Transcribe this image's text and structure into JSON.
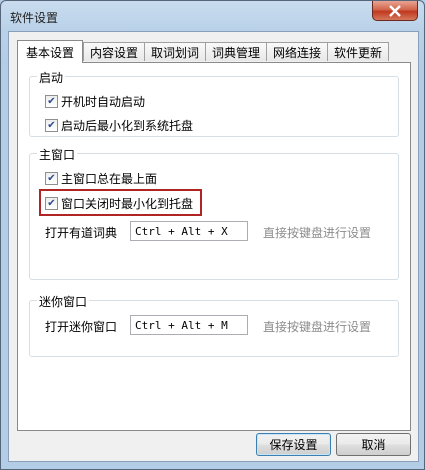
{
  "window": {
    "title": "软件设置"
  },
  "tabs": [
    {
      "label": "基本设置",
      "active": true
    },
    {
      "label": "内容设置",
      "active": false
    },
    {
      "label": "取词划词",
      "active": false
    },
    {
      "label": "词典管理",
      "active": false
    },
    {
      "label": "网络连接",
      "active": false
    },
    {
      "label": "软件更新",
      "active": false
    }
  ],
  "startup": {
    "title": "启动",
    "options": [
      {
        "label": "开机时自动启动",
        "checked": true
      },
      {
        "label": "启动后最小化到系统托盘",
        "checked": true
      }
    ]
  },
  "main_window": {
    "title": "主窗口",
    "options": [
      {
        "label": "主窗口总在最上面",
        "checked": true
      },
      {
        "label": "窗口关闭时最小化到托盘",
        "checked": true,
        "highlighted": true
      }
    ],
    "hotkey_label": "打开有道词典",
    "hotkey_value": "Ctrl + Alt + X",
    "hotkey_hint": "直接按键盘进行设置"
  },
  "mini_window": {
    "title": "迷你窗口",
    "hotkey_label": "打开迷你窗口",
    "hotkey_value": "Ctrl + Alt + M",
    "hotkey_hint": "直接按键盘进行设置"
  },
  "buttons": {
    "save": "保存设置",
    "cancel": "取消"
  },
  "colors": {
    "highlight": "#b02424",
    "close_button": "#c0391f"
  }
}
